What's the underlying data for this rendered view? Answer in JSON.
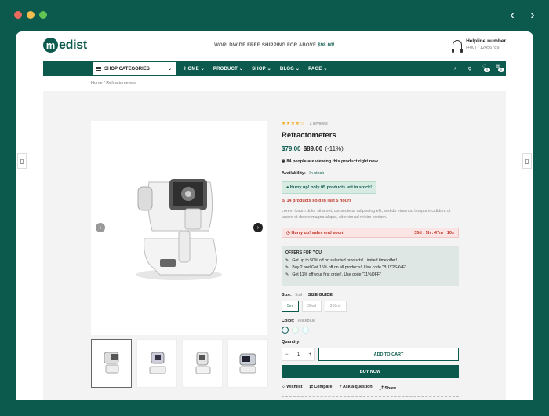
{
  "browser": {
    "dots": [
      "#ea6b5e",
      "#f5bd4f",
      "#61c554"
    ],
    "back_icon": "chevron-left-icon",
    "forward_icon": "chevron-right-icon"
  },
  "header": {
    "logo_letter": "m",
    "logo_text": "edist",
    "shipping_text": "WORLDWIDE FREE SHIPPING FOR ABOVE",
    "shipping_amount": "$98.00!",
    "helpline_title": "Helpline number",
    "helpline_phone": "(+00) - 12456789"
  },
  "nav": {
    "categories_label": "SHOP CATEGORIES",
    "links": [
      "HOME",
      "PRODUCT",
      "SHOP",
      "BLOG",
      "PAGE"
    ],
    "cart_count": "0",
    "wishlist_count": "0"
  },
  "breadcrumb": "Home / Refractometers",
  "product": {
    "rating": 4,
    "stars": "★★★★☆",
    "reviews": "2 reviews",
    "title": "Refractometers",
    "price_now": "$79.00",
    "price_old": "$89.00",
    "discount": "(-11%)",
    "viewing": "84 people are viewing this product right now",
    "availability_label": "Availability:",
    "availability_value": "In stock",
    "stock_alert": "Hurry up! only 05 products left in stock!",
    "sold_text": "14 products sold in last 5 hours",
    "description": "Lorem ipsum dolor sit amet, consectetur adipiscing elit, sed do eiusmod tempor incididunt ut labore et dolore magna aliqua, sit enim ad minim veniam.",
    "timer_label": "Hurry up! sales end soon!",
    "timer_value": "35d : 5h : 47m : 10s",
    "offers_title": "OFFERS FOR YOU",
    "offers": [
      "Get up to 50% off on selected products! Limited time offer!",
      "Buy 2 and Get 15% off on all products!, Use code \"BUY2SAVE\"",
      "Get 11% off your first order!, Use code \"11%OFF\""
    ],
    "size_label": "Size:",
    "size_selected": "5ml",
    "size_guide": "SIZE GUIDE",
    "sizes": [
      "5ml",
      "30ml",
      "250ml"
    ],
    "color_label": "Color:",
    "color_selected": "Aliceblue",
    "colors": [
      "#f0f8ff",
      "#f0fff0",
      "#f0ffff"
    ],
    "quantity_label": "Quantity:",
    "quantity": "1",
    "add_to_cart": "ADD TO CART",
    "buy_now": "BUY NOW",
    "actions": [
      "Wishlist",
      "Compare",
      "Ask a question",
      "Share"
    ]
  },
  "colors": {
    "brand": "#0c5a4d",
    "background": "#f3f3f3",
    "alert_red": "#c0392b"
  }
}
